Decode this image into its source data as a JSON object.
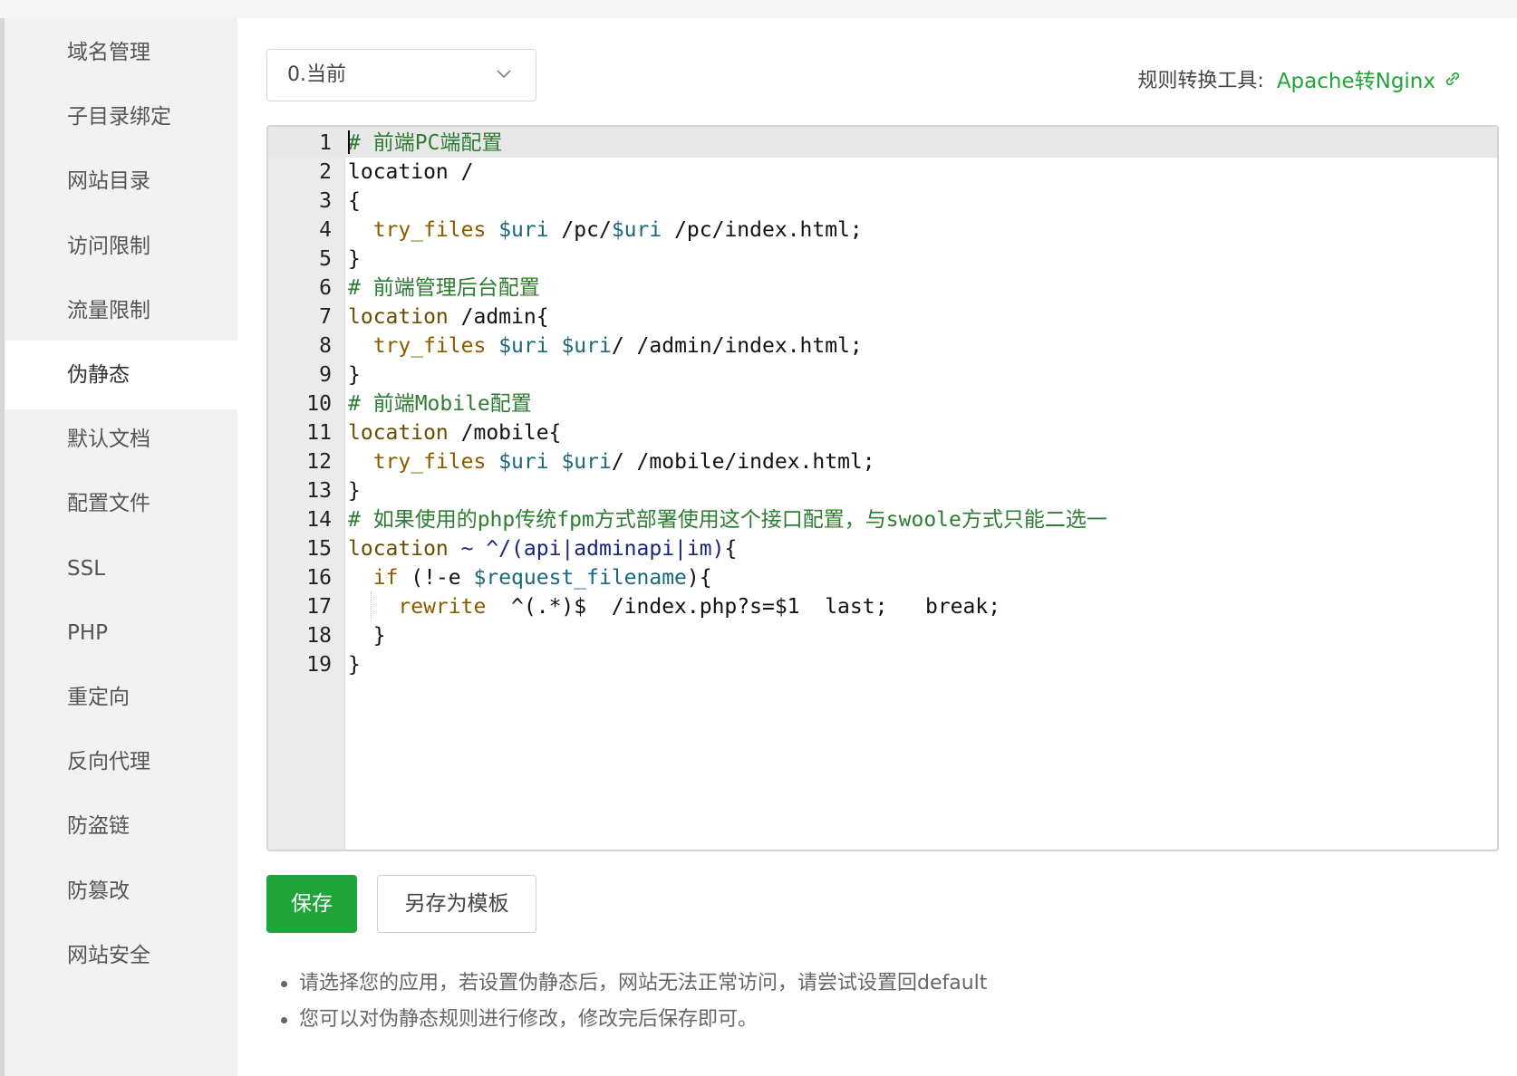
{
  "sidebar": {
    "items": [
      {
        "label": "域名管理",
        "active": false
      },
      {
        "label": "子目录绑定",
        "active": false
      },
      {
        "label": "网站目录",
        "active": false
      },
      {
        "label": "访问限制",
        "active": false
      },
      {
        "label": "流量限制",
        "active": false
      },
      {
        "label": "伪静态",
        "active": true
      },
      {
        "label": "默认文档",
        "active": false
      },
      {
        "label": "配置文件",
        "active": false
      },
      {
        "label": "SSL",
        "active": false
      },
      {
        "label": "PHP",
        "active": false
      },
      {
        "label": "重定向",
        "active": false
      },
      {
        "label": "反向代理",
        "active": false
      },
      {
        "label": "防盗链",
        "active": false
      },
      {
        "label": "防篡改",
        "active": false
      },
      {
        "label": "网站安全",
        "active": false
      }
    ]
  },
  "toolbar": {
    "template_select_value": "0.当前",
    "converter_label": "规则转换工具:",
    "converter_link": "Apache转Nginx"
  },
  "editor": {
    "lines": [
      [
        [
          "c",
          "# 前端PC端配置"
        ]
      ],
      [
        [
          "p",
          "location /"
        ]
      ],
      [
        [
          "p",
          "{"
        ]
      ],
      [
        [
          "p",
          "  "
        ],
        [
          "f",
          "try_files"
        ],
        [
          "p",
          " "
        ],
        [
          "v",
          "$uri"
        ],
        [
          "p",
          " /pc/"
        ],
        [
          "v",
          "$uri"
        ],
        [
          "p",
          " /pc/index.html;"
        ]
      ],
      [
        [
          "p",
          "}"
        ]
      ],
      [
        [
          "c",
          "# 前端管理后台配置"
        ]
      ],
      [
        [
          "k",
          "location"
        ],
        [
          "p",
          " /admin{"
        ]
      ],
      [
        [
          "p",
          "  "
        ],
        [
          "f",
          "try_files"
        ],
        [
          "p",
          " "
        ],
        [
          "v",
          "$uri"
        ],
        [
          "p",
          " "
        ],
        [
          "v",
          "$uri"
        ],
        [
          "p",
          "/ /admin/index.html;"
        ]
      ],
      [
        [
          "p",
          "}"
        ]
      ],
      [
        [
          "c",
          "# 前端Mobile配置"
        ]
      ],
      [
        [
          "k",
          "location"
        ],
        [
          "p",
          " /mobile{"
        ]
      ],
      [
        [
          "p",
          "  "
        ],
        [
          "f",
          "try_files"
        ],
        [
          "p",
          " "
        ],
        [
          "v",
          "$uri"
        ],
        [
          "p",
          " "
        ],
        [
          "v",
          "$uri"
        ],
        [
          "p",
          "/ /mobile/index.html;"
        ]
      ],
      [
        [
          "p",
          "}"
        ]
      ],
      [
        [
          "c",
          "# 如果使用的php传统fpm方式部署使用这个接口配置，与swoole方式只能二选一"
        ]
      ],
      [
        [
          "k",
          "location"
        ],
        [
          "p",
          " "
        ],
        [
          "r",
          "~ ^/(api|adminapi|im)"
        ],
        [
          "p",
          "{"
        ]
      ],
      [
        [
          "p",
          "  "
        ],
        [
          "f",
          "if"
        ],
        [
          "p",
          " (!-e "
        ],
        [
          "v",
          "$request_filename"
        ],
        [
          "p",
          "){"
        ]
      ],
      [
        [
          "p",
          "    "
        ],
        [
          "f",
          "rewrite"
        ],
        [
          "p",
          "  ^(.*)$  /index.php?s=$1  last;   break;"
        ]
      ],
      [
        [
          "p",
          "  }"
        ]
      ],
      [
        [
          "p",
          "}"
        ]
      ]
    ]
  },
  "buttons": {
    "save": "保存",
    "save_as_template": "另存为模板"
  },
  "tips": [
    "请选择您的应用，若设置伪静态后，网站无法正常访问，请尝试设置回default",
    "您可以对伪静态规则进行修改，修改完后保存即可。"
  ],
  "colors": {
    "accent": "#20a53a",
    "comment": "#2e7d32",
    "keyword": "#6b4c00",
    "variable": "#19697a"
  },
  "icons": {
    "select_arrow": "chevron-down-icon",
    "converter_link": "link-icon"
  }
}
